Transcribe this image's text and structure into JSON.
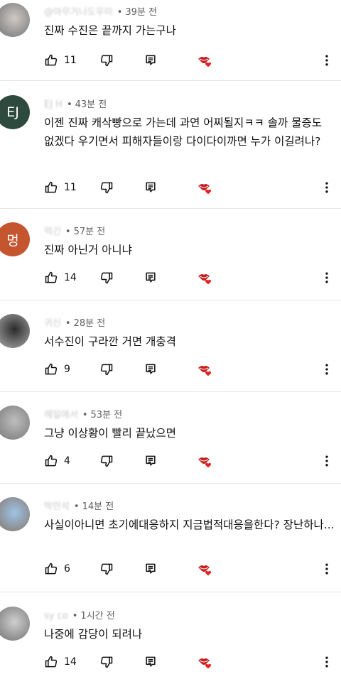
{
  "comments": [
    {
      "author": "@아무거나도우미",
      "time": "39분 전",
      "text": "진짜 수진은  끝까지 가는구나",
      "likes": "11",
      "avatar_letter": "",
      "avatar_color": "#cfc9c4",
      "avatar_photo": true
    },
    {
      "author": "EJ H",
      "time": "43분 전",
      "text": "이젠 진짜 캐삭빵으로 가는데 과연 어찌될지ㅋㅋ 솔까 물증도 없겠다 우기면서 피해자들이랑 다이다이까면 누가 이길려나?",
      "likes": "11",
      "avatar_letter": "EJ",
      "avatar_color": "#2e4a3f",
      "avatar_photo": false
    },
    {
      "author": "먹긴",
      "time": "57분 전",
      "text": "진짜 아닌거 아니냐",
      "likes": "14",
      "avatar_letter": "멍",
      "avatar_color": "#c4552e",
      "avatar_photo": false
    },
    {
      "author": "귀신",
      "time": "28분 전",
      "text": "서수진이 구라깐 거면 개충격",
      "likes": "9",
      "avatar_letter": "",
      "avatar_color": "#2b2b2b",
      "avatar_photo": true
    },
    {
      "author": "헤일에서",
      "time": "53분 전",
      "text": "그냥 이상황이 빨리 끝났으면",
      "likes": "4",
      "avatar_letter": "",
      "avatar_color": "#bdbdbd",
      "avatar_photo": true
    },
    {
      "author": "박민석",
      "time": "14분 전",
      "text": "사실이아니면 초기에대응하지 지금법적대응을한다? 장난하나...",
      "likes": "6",
      "avatar_letter": "",
      "avatar_color": "#9fc3e6",
      "avatar_photo": true
    },
    {
      "author": "sy co",
      "time": "1시간 전",
      "text": "나중에 감당이 되려나",
      "likes": "14",
      "avatar_letter": "",
      "avatar_color": "#cfcfcf",
      "avatar_photo": true
    }
  ],
  "colors": {
    "heart": "#e8201d",
    "lips": "#c41e1e",
    "text": "#0f0f0f",
    "meta": "#606060",
    "divider": "#e5e5e5"
  },
  "icons": {
    "like": "thumbs-up-icon",
    "dislike": "thumbs-down-icon",
    "reply": "reply-icon",
    "creator_heart": "creator-heart-icon",
    "more": "more-vert-icon"
  }
}
